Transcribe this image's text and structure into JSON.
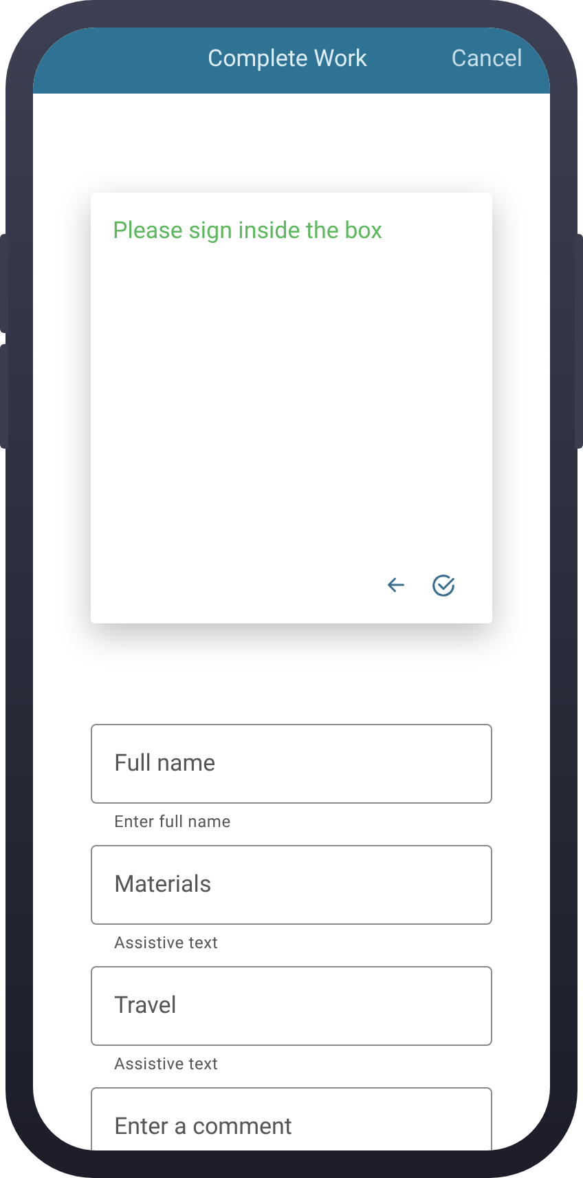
{
  "header": {
    "title": "Complete Work",
    "action": "Cancel"
  },
  "signature": {
    "prompt": "Please sign inside the box"
  },
  "fields": [
    {
      "placeholder": "Full name",
      "helper": "Enter full name"
    },
    {
      "placeholder": "Materials",
      "helper": "Assistive text"
    },
    {
      "placeholder": "Travel",
      "helper": "Assistive text"
    },
    {
      "placeholder": "Enter a comment"
    }
  ]
}
